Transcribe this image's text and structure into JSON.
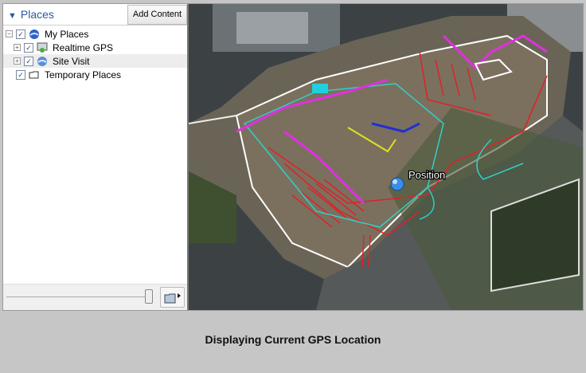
{
  "places_panel": {
    "title": "Places",
    "add_content_label": "Add Content",
    "tree": [
      {
        "label": "My Places",
        "icon": "google-earth-globe-icon",
        "checked": true,
        "expanded": true
      },
      {
        "label": "Realtime GPS",
        "icon": "gps-receiver-icon",
        "checked": true,
        "expanded": false
      },
      {
        "label": "Site Visit",
        "icon": "google-earth-globe-icon",
        "checked": true,
        "expanded": false,
        "selected": true
      },
      {
        "label": "Temporary Places",
        "icon": "folder-icon",
        "checked": true
      }
    ]
  },
  "map": {
    "marker_label": "Position"
  },
  "caption": "Displaying Current GPS Location",
  "colors": {
    "accent": "#2a5a9c",
    "cad_red": "#e0202a",
    "cad_cyan": "#30d0c8",
    "cad_magenta": "#e030e0"
  }
}
